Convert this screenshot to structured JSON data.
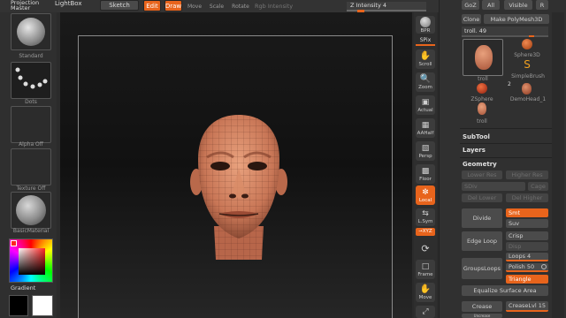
{
  "top_toolbar": {
    "projection_master": "Projection\nMaster",
    "lightbox": "LightBox",
    "sketch": "Sketch",
    "edit": "Edit",
    "draw": "Draw",
    "move": "Move",
    "scale": "Scale",
    "rotate": "Rotate",
    "rgb_intensity": "Rgb Intensity",
    "z_intensity": "Z Intensity 4"
  },
  "left_tray": {
    "brush_label": "Standard",
    "stroke_label": "Dots",
    "alpha_label": "Alpha Off",
    "texture_label": "Texture Off",
    "material_label": "BasicMaterial",
    "gradient_label": "Gradient"
  },
  "right_shelf": {
    "bpr": "BPR",
    "spix": "SPix",
    "scroll": "Scroll",
    "zoom": "Zoom",
    "actual": "Actual",
    "aahalf": "AAHalf",
    "persp": "Persp",
    "floor": "Floor",
    "local": "Local",
    "lsym": "L.Sym",
    "xyz": "⭢XYZ",
    "frame": "Frame",
    "move": "Move"
  },
  "tool_palette": {
    "goz": "GoZ",
    "all": "All",
    "visible": "Visible",
    "r": "R",
    "clone": "Clone",
    "make_polymesh": "Make PolyMesh3D",
    "current_tool": "troll. 49",
    "tools": [
      "troll",
      "Sphere3D",
      "SimpleBrush",
      "ZSphere",
      "DemoHead_1",
      "troll"
    ],
    "badge2": "2"
  },
  "subtool_panel": {
    "subtool": "SubTool",
    "layers": "Layers",
    "geometry": "Geometry",
    "lower_res": "Lower Res",
    "higher_res": "Higher Res",
    "sdiv": "SDiv",
    "cage": "Cage",
    "del_lower": "Del Lower",
    "del_higher": "Del Higher",
    "divide": "Divide",
    "smt": "Smt",
    "suv": "Suv",
    "edge_loop": "Edge Loop",
    "crisp": "Crisp",
    "disp": "Disp",
    "loops": "Loops 4",
    "groups_loops": "GroupsLoops",
    "polish": "Polish 50",
    "triangle": "Triangle",
    "equalize": "Equalize Surface Area",
    "crease": "Crease",
    "crease_lvl": "CreaseLvl 15",
    "uncrease": "Uncrease"
  },
  "colors": {
    "accent": "#e8641c",
    "panel_bg": "#3a3a3a",
    "canvas_bg": "#151515"
  }
}
